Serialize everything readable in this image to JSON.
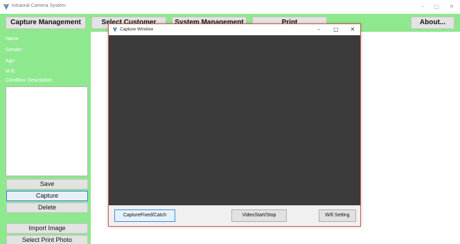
{
  "window": {
    "title": "Intraoral Camera System",
    "minimize_glyph": "–",
    "maximize_glyph": "▢",
    "close_glyph": "✕"
  },
  "menu": {
    "capture_management": "Capture Management",
    "select_customer": "Select Customer",
    "system_management": "System Management",
    "print": "Print",
    "about": "About..."
  },
  "patient": {
    "name_label": "Name:",
    "gender_label": "Gender:",
    "age_label": "Age:",
    "mb_label": "M.B:",
    "condition_label": "Condition Description:"
  },
  "side_buttons": {
    "save": "Save",
    "capture": "Capture",
    "delete": "Delete",
    "import_image": "Import Image",
    "select_print_photo": "Select Print Photo"
  },
  "capture_window": {
    "title": "Capture Window",
    "minimize_glyph": "–",
    "maximize_glyph": "▢",
    "close_glyph": "✕",
    "capture_fixed_catch": "CaptureFixed/Catch",
    "video_start_stop": "VideoStart/Stop",
    "wifi_setting": "Wifi Setting"
  },
  "colors": {
    "accent_green": "#8ee88e",
    "video_background": "#3b3b3b",
    "focus_blue": "#2f7fd8",
    "capture_window_border": "#d25b3f"
  },
  "icons": {
    "app_icon": "app-logo-icon",
    "capture_window_icon": "app-logo-icon"
  }
}
